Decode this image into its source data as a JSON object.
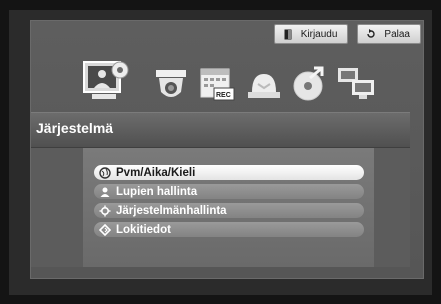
{
  "header": {
    "login_label": "Kirjaudu",
    "back_label": "Palaa"
  },
  "icons": [
    {
      "name": "system-setup-icon",
      "selected": true
    },
    {
      "name": "camera-icon"
    },
    {
      "name": "record-calendar-icon"
    },
    {
      "name": "event-alarm-icon"
    },
    {
      "name": "backup-disc-icon"
    },
    {
      "name": "network-icon"
    }
  ],
  "section": {
    "title": "Järjestelmä"
  },
  "menu": {
    "items": [
      {
        "label": "Pvm/Aika/Kieli",
        "icon": "globe-icon",
        "active": true
      },
      {
        "label": "Lupien hallinta",
        "icon": "user-icon"
      },
      {
        "label": "Järjestelmänhallinta",
        "icon": "gear-icon"
      },
      {
        "label": "Lokitiedot",
        "icon": "log-icon"
      }
    ]
  },
  "colors": {
    "screen_bg": "#5e5e5e",
    "active_item": "#ffffff",
    "item_bg": "#8d8d8d"
  }
}
